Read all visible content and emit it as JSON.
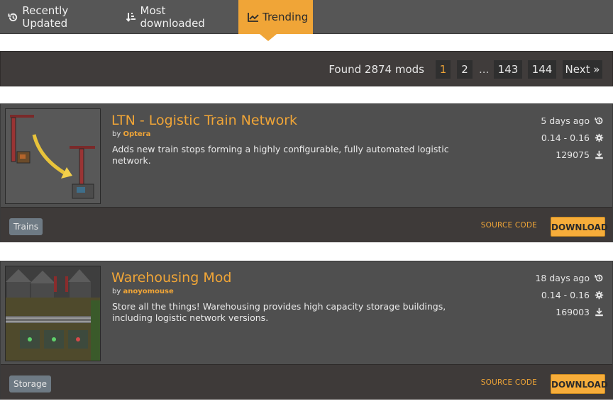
{
  "tabs": [
    {
      "label": "Recently Updated",
      "icon": "history-icon",
      "active": false
    },
    {
      "label": "Most downloaded",
      "icon": "sort-icon",
      "active": false
    },
    {
      "label": "Trending",
      "icon": "trend-chart-icon",
      "active": true
    }
  ],
  "pagination": {
    "found_text": "Found 2874 mods",
    "pages": [
      "1",
      "2",
      "143",
      "144"
    ],
    "current": "1",
    "ellipsis": "...",
    "next_label": "Next »"
  },
  "mods": [
    {
      "title": "LTN - Logistic Train Network",
      "by": "by",
      "author": "Optera",
      "summary": "Adds new train stops forming a highly configurable, fully automated logistic network.",
      "updated": "5 days ago",
      "versions": "0.14 - 0.16",
      "downloads": "129075",
      "tag": "Trains",
      "source_label": "SOURCE CODE",
      "download_label": "DOWNLOAD"
    },
    {
      "title": "Warehousing Mod",
      "by": "by",
      "author": "anoyomouse",
      "summary": "Store all the things! Warehousing provides high capacity storage buildings, including logistic network versions.",
      "updated": "18 days ago",
      "versions": "0.14 - 0.16",
      "downloads": "169003",
      "tag": "Storage",
      "source_label": "SOURCE CODE",
      "download_label": "DOWNLOAD"
    }
  ],
  "colors": {
    "accent": "#f0a537",
    "bar": "#565656",
    "card": "#4f4f4f",
    "footer": "#3e3a39",
    "tag": "#6e7a84"
  }
}
